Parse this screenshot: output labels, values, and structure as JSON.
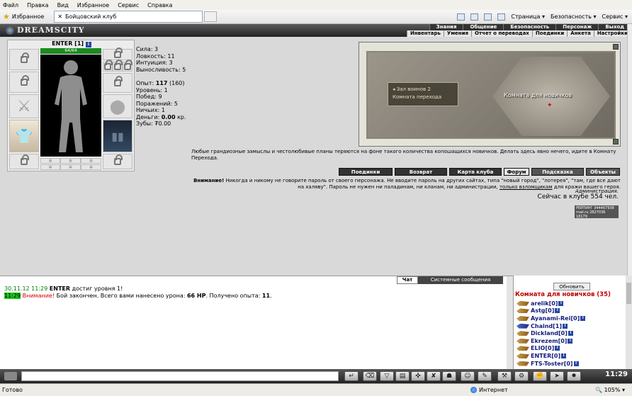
{
  "browser": {
    "menu": [
      "Файл",
      "Правка",
      "Вид",
      "Избранное",
      "Сервис",
      "Справка"
    ],
    "favorites_label": "Избранное",
    "tab_title": "Бойцовский клуб",
    "commands": [
      "Страница",
      "Безопасность",
      "Сервис"
    ],
    "status_ready": "Готово",
    "status_zone": "Интернет",
    "zoom": "105%"
  },
  "header": {
    "logo": "DREAMSCITY",
    "main_nav": [
      "Знания",
      "Общение",
      "Безопасность",
      "Персонаж",
      "Выход"
    ],
    "sub_nav": [
      "Инвентарь",
      "Умения",
      "Отчет о переводах",
      "Поединки",
      "Анкета",
      "Настройки"
    ]
  },
  "character": {
    "name": "ENTER [1]",
    "hp": "64/64",
    "stats": [
      "Сила: 3",
      "Ловкость: 11",
      "Интуиция: 3",
      "Выносливость: 5"
    ],
    "exp_label": "Опыт:",
    "exp_value": "117",
    "exp_next": "(160)",
    "level": "Уровень: 1",
    "wins": "Побед: 9",
    "losses": "Поражений: 5",
    "draws": "Ничьих: 1",
    "money_label": "Деньги:",
    "money_value": "0.00",
    "money_unit": "кр.",
    "teeth": "Зубы: ₮0.00"
  },
  "map": {
    "sign_line1": "Зал воинов 2",
    "sign_line2": "Комната перехода",
    "room_label": "Комната для новичков"
  },
  "intro": "Любые грандиозные замыслы и честолюбивые планы теряются на фоне такого количества копошащихся новичков. Делать здесь явно нечего, идите в Комнату Перехода.",
  "buttons": [
    "Поединки",
    "Возврат",
    "Карта клуба",
    "Форум",
    "Подсказка",
    "Объекты"
  ],
  "warning": {
    "bold": "Внимание!",
    "text1": " Никогда и никому не говорите пароль от своего персонажа. Не вводите пароль на других сайтах, типа \"новый город\", \"лотерея\", \"там, где все дают на халяву\". Пароль не нужен ни паладинам, ни кланам, ни администрации, ",
    "link": "только взломщикам",
    "text2": " для кражи вашего героя.",
    "admin": "Администрация.",
    "online": "Сейчас в клубе 554 чел."
  },
  "counter": {
    "line1": "РЕЙТИНГ 344467938",
    "line2": "mail.ru 2827036",
    "line3": "18179"
  },
  "chat": {
    "tab_chat": "Чат",
    "tab_system": "Системные сообщения",
    "line1_time": "30.11.12 11:29",
    "line1_name": "ENTER",
    "line1_text": " достиг уровня 1!",
    "line2_time": "11:29",
    "line2_warn": "Внимание!",
    "line2_text1": " Бой закончен. Всего вами нанесено урона: ",
    "line2_dmg": "66 HP",
    "line2_text2": ". Получено опыта: ",
    "line2_exp": "11",
    "line2_end": "."
  },
  "users": {
    "refresh": "Обновить",
    "room_title": "Комната для новичков (35)",
    "list": [
      {
        "name": "arelik",
        "level": "[0]",
        "icon": "gold"
      },
      {
        "name": "Astg",
        "level": "[0]",
        "icon": "gold"
      },
      {
        "name": "Ayanami-Rei",
        "level": "[0]",
        "icon": "gold"
      },
      {
        "name": "Chaind",
        "level": "[1]",
        "icon": "blue"
      },
      {
        "name": "Dickland",
        "level": "[0]",
        "icon": "gold"
      },
      {
        "name": "Ekrezem",
        "level": "[0]",
        "icon": "gold"
      },
      {
        "name": "ELIO",
        "level": "[0]",
        "icon": "gold"
      },
      {
        "name": "ENTER",
        "level": "[0]",
        "icon": "gold"
      },
      {
        "name": "FTS-Toster",
        "level": "[0]",
        "icon": "gold"
      }
    ]
  },
  "toolbar": {
    "clock": "11:29"
  }
}
